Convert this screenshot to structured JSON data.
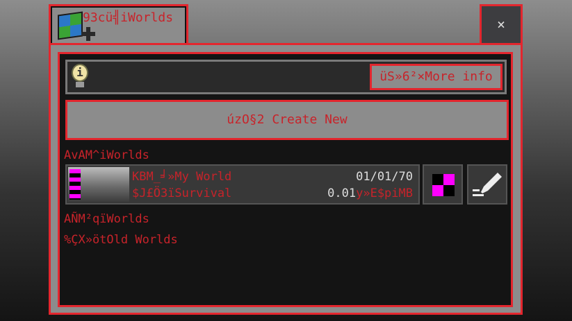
{
  "tab": {
    "title": "93cü╣iWorlds"
  },
  "close": {
    "label": "×"
  },
  "info": {
    "more_info_label": "üS»6²×More info"
  },
  "create": {
    "label": "úzO§2 Create New"
  },
  "sections": {
    "worlds": "AvAM^iWorlds",
    "realms": "AÑM²qïWorlds",
    "old": "%ÇX»ötOld Worlds"
  },
  "world_rows": [
    {
      "name": "KBM_╛»My World",
      "mode": "$J£Ö3ïSurvival",
      "date": "01/01/70",
      "size_value": "0.01",
      "size_unit": "y»E$piMB"
    }
  ],
  "colors": {
    "accent_red": "#e3262e",
    "text_red": "#c8232a",
    "missing_texture": "#ff00ff"
  }
}
